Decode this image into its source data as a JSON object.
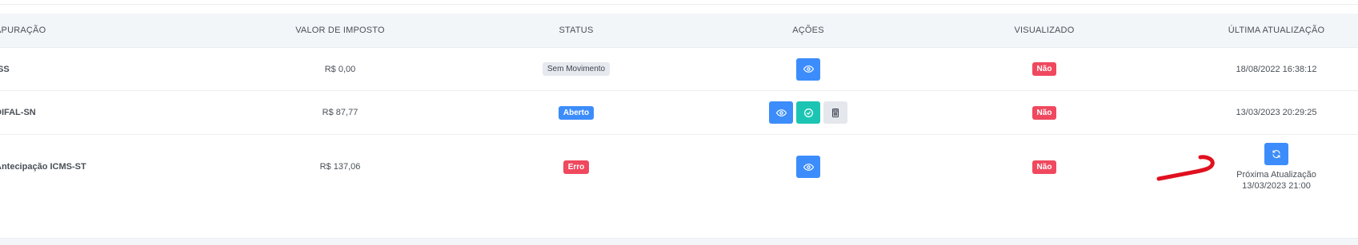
{
  "table": {
    "headers": {
      "apuracao": "APURAÇÃO",
      "valor": "VALOR DE IMPOSTO",
      "status": "STATUS",
      "acoes": "AÇÕES",
      "visualizado": "VISUALIZADO",
      "ultima": "ÚLTIMA ATUALIZAÇÃO"
    },
    "rows": [
      {
        "name": "ISS",
        "valor": "R$ 0,00",
        "status": "Sem Movimento",
        "visualizado": "Não",
        "ultima": "18/08/2022 16:38:12"
      },
      {
        "name": "DIFAL-SN",
        "valor": "R$ 87,77",
        "status": "Aberto",
        "visualizado": "Não",
        "ultima": "13/03/2023 20:29:25"
      },
      {
        "name": "Antecipação ICMS-ST",
        "valor": "R$ 137,06",
        "status": "Erro",
        "visualizado": "Não",
        "proxima_label": "Próxima Atualização",
        "proxima_date": "13/03/2023 21:00"
      }
    ]
  },
  "colors": {
    "primary": "#3c8dfb",
    "teal": "#1cc5b3",
    "danger": "#f0485e",
    "annotation": "#e0101f"
  },
  "icons": {
    "view": "eye-icon",
    "approve": "check-circle-icon",
    "calculator": "calculator-icon",
    "refresh": "refresh-icon"
  }
}
